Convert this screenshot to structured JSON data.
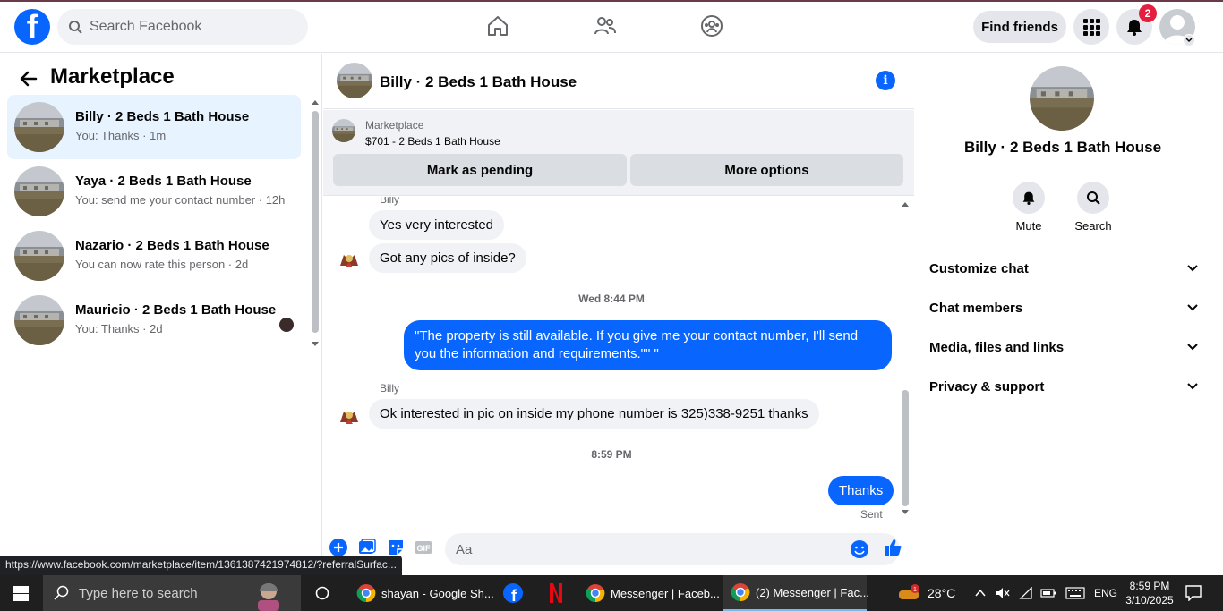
{
  "header": {
    "search_placeholder": "Search Facebook",
    "find_friends_label": "Find friends",
    "notification_count": "2"
  },
  "left": {
    "title": "Marketplace",
    "conversations": [
      {
        "name": "Billy · 2 Beds 1 Bath House",
        "snippet": "You: Thanks · 1m",
        "active": true
      },
      {
        "name": "Yaya · 2 Beds 1 Bath House",
        "snippet": "You: send me your contact number · 12h",
        "active": false
      },
      {
        "name": "Nazario · 2 Beds 1 Bath House",
        "snippet": "You can now rate this person · 2d",
        "active": false
      },
      {
        "name": "Mauricio · 2 Beds 1 Bath House",
        "snippet": "You: Thanks · 2d",
        "active": false
      }
    ]
  },
  "chat": {
    "title": "Billy · 2 Beds 1 Bath House",
    "listing_label": "Marketplace",
    "listing_price": "$701 - 2 Beds 1 Bath House",
    "mark_pending_label": "Mark as pending",
    "more_options_label": "More options",
    "messages": {
      "sender_top": "Billy",
      "in1": "Yes very interested",
      "in2": "Got any pics of inside?",
      "ts1": "Wed 8:44 PM",
      "out1": "\"The property is still available. If you give me your contact number, I'll send you the information and requirements.\"\"          \"",
      "sender2": "Billy",
      "in3": "Ok interested in pic on inside my phone number is 325)338-9251 thanks",
      "ts2": "8:59 PM",
      "out2": "Thanks",
      "sent_label": "Sent"
    },
    "composer_placeholder": "Aa"
  },
  "right": {
    "title": "Billy · 2 Beds 1 Bath House",
    "mute_label": "Mute",
    "search_label": "Search",
    "sections": [
      "Customize chat",
      "Chat members",
      "Media, files and links",
      "Privacy & support"
    ]
  },
  "status_url": "https://www.facebook.com/marketplace/item/1361387421974812/?referralSurfac...",
  "taskbar": {
    "search_placeholder": "Type here to search",
    "apps": [
      "shayan - Google Sh...",
      "Messenger | Faceb...",
      "(2) Messenger | Fac..."
    ],
    "temperature": "28°C",
    "language": "ENG",
    "time": "8:59 PM",
    "date": "3/10/2025",
    "weather_badge": "1"
  },
  "colors": {
    "brand_blue": "#0866ff",
    "notification_red": "#e41e3f",
    "active_conv_bg": "#e7f3ff"
  }
}
